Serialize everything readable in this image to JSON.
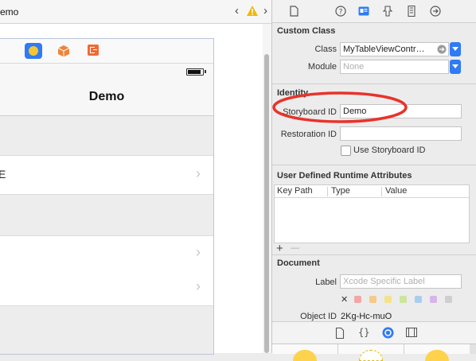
{
  "jumpbar": {
    "title": "emo",
    "warning": "⚠"
  },
  "scene": {
    "nav_title": "Demo",
    "cell_label_fragment": "E",
    "chevron": "›"
  },
  "inspector": {
    "custom_class": {
      "title": "Custom Class",
      "class_label": "Class",
      "class_value": "MyTableViewContr…",
      "module_label": "Module",
      "module_placeholder": "None"
    },
    "identity": {
      "title": "Identity",
      "storyboard_id_label": "Storyboard ID",
      "storyboard_id_value": "Demo",
      "restoration_id_label": "Restoration ID",
      "restoration_id_value": "",
      "use_storyboard_id_label": "Use Storyboard ID",
      "use_storyboard_id_checked": false
    },
    "udra": {
      "title": "User Defined Runtime Attributes",
      "columns": [
        "Key Path",
        "Type",
        "Value"
      ],
      "add": "+",
      "remove": "—"
    },
    "document": {
      "title": "Document",
      "label_label": "Label",
      "label_placeholder": "Xcode Specific Label",
      "clear_color": "✕",
      "object_id_label": "Object ID",
      "object_id_value": "2Kg-Hc-muO",
      "label_colors": [
        "#f4a6a6",
        "#f7c98a",
        "#f4e38a",
        "#c9e69a",
        "#a9cdf0",
        "#d7b5ea",
        "#cfcfcf"
      ]
    }
  },
  "colors": {
    "annotation": "#e8332b",
    "accent": "#2f7bf5"
  }
}
